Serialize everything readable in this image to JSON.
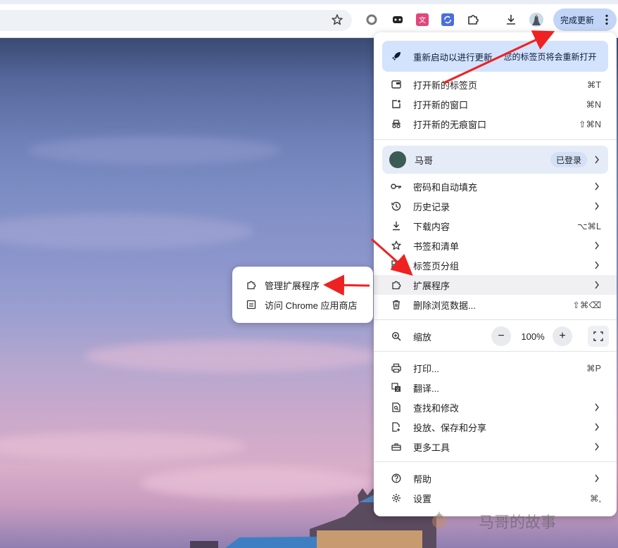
{
  "toolbar": {
    "update_label": "完成更新",
    "extension_icons": [
      "circle-extension-icon",
      "gamepad-extension-icon",
      "translate-extension-icon",
      "sync-extension-icon",
      "puzzle-extensions-icon"
    ]
  },
  "menu": {
    "banner": {
      "label": "重新启动以进行更新",
      "sub": "您的标签页将会重新打开"
    },
    "items_top": [
      {
        "label": "打开新的标签页",
        "shortcut": "⌘T",
        "icon": "new-tab-icon"
      },
      {
        "label": "打开新的窗口",
        "shortcut": "⌘N",
        "icon": "new-window-icon"
      },
      {
        "label": "打开新的无痕窗口",
        "shortcut": "⇧⌘N",
        "icon": "incognito-icon"
      }
    ],
    "profile": {
      "name": "马哥",
      "status": "已登录"
    },
    "items_mid": [
      {
        "label": "密码和自动填充",
        "icon": "key-icon",
        "shortcut": ""
      },
      {
        "label": "历史记录",
        "icon": "history-icon",
        "shortcut": ""
      },
      {
        "label": "下载内容",
        "icon": "download-icon",
        "shortcut": "⌥⌘L"
      },
      {
        "label": "书签和清单",
        "icon": "star-icon",
        "shortcut": ""
      },
      {
        "label": "标签页分组",
        "icon": "tab-groups-icon",
        "shortcut": ""
      },
      {
        "label": "扩展程序",
        "icon": "puzzle-icon",
        "shortcut": ""
      },
      {
        "label": "删除浏览数据...",
        "icon": "trash-icon",
        "shortcut": "⇧⌘⌫"
      }
    ],
    "zoom": {
      "label": "缩放",
      "value": "100%",
      "minus": "−",
      "plus": "+"
    },
    "items_tools": [
      {
        "label": "打印...",
        "icon": "print-icon",
        "shortcut": "⌘P"
      },
      {
        "label": "翻译...",
        "icon": "translate-icon",
        "shortcut": ""
      },
      {
        "label": "查找和修改",
        "icon": "find-icon",
        "shortcut": ""
      },
      {
        "label": "投放、保存和分享",
        "icon": "cast-save-icon",
        "shortcut": ""
      },
      {
        "label": "更多工具",
        "icon": "toolbox-icon",
        "shortcut": ""
      }
    ],
    "items_bottom": [
      {
        "label": "帮助",
        "icon": "help-icon",
        "shortcut": ""
      },
      {
        "label": "设置",
        "icon": "gear-icon",
        "shortcut": "⌘,"
      }
    ]
  },
  "submenu": {
    "items": [
      {
        "label": "管理扩展程序",
        "icon": "puzzle-icon"
      },
      {
        "label": "访问 Chrome 应用商店",
        "icon": "store-icon"
      }
    ]
  },
  "watermark": {
    "text": "马哥的故事"
  },
  "colors": {
    "banner_bg": "#d3e3fd",
    "arrow": "#ee2222",
    "update_btn": "#c2d5f7"
  }
}
